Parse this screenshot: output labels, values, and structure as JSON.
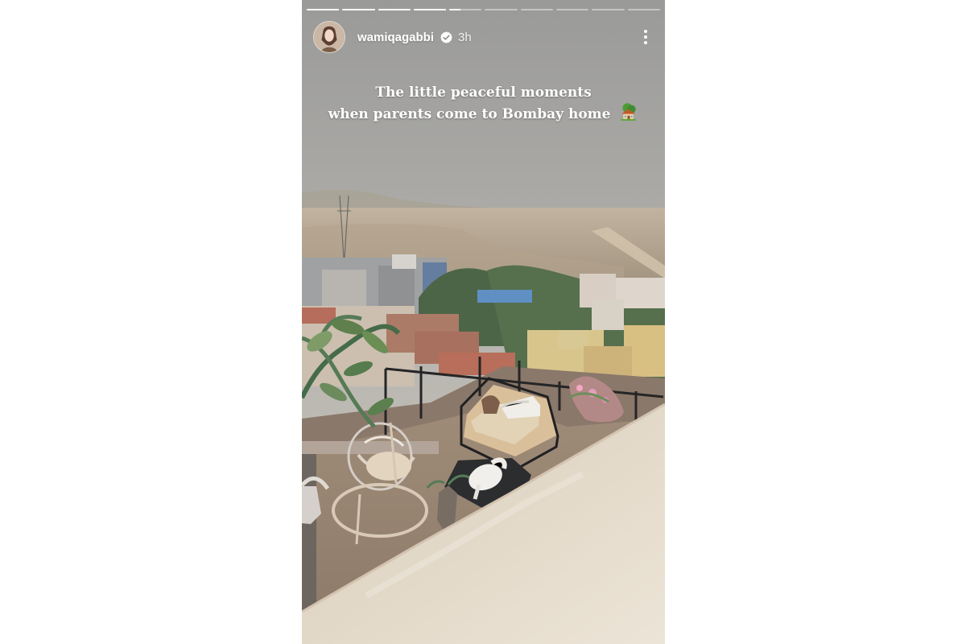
{
  "story": {
    "progress": {
      "segment_count": 10,
      "completed_segments": 4,
      "current_segment_fill": 0.35
    },
    "header": {
      "username": "wamiqagabbi",
      "verified": true,
      "timestamp": "3h"
    },
    "caption": {
      "line1": "The little peaceful moments",
      "line2": "when parents come to Bombay home",
      "emoji": "house-with-garden-icon"
    },
    "icons": {
      "verified_badge": "verified-badge-icon",
      "more": "more-options-icon"
    }
  }
}
